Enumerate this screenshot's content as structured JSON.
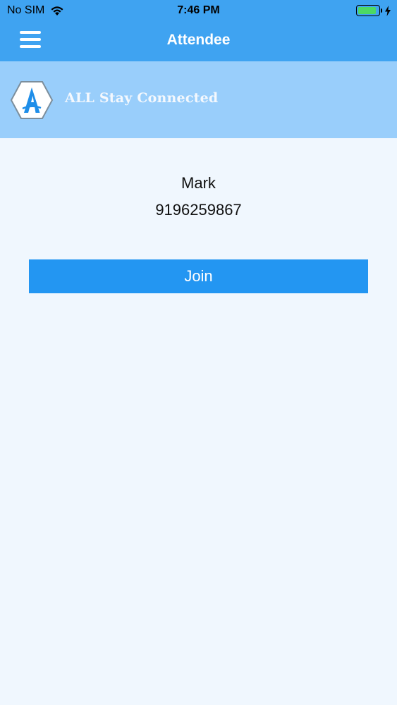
{
  "status_bar": {
    "carrier": "No SIM",
    "time": "7:46 PM",
    "battery_level": 0.9,
    "icons": [
      "wifi-icon",
      "battery-icon",
      "charging-bolt-icon"
    ]
  },
  "nav": {
    "title": "Attendee",
    "menu_icon": "hamburger-menu-icon"
  },
  "brand": {
    "logo_letter": "A",
    "name": "ALL Stay Connected"
  },
  "attendee": {
    "name": "Mark",
    "phone": "9196259867"
  },
  "actions": {
    "join_label": "Join"
  },
  "colors": {
    "nav_bg": "#3FA3F1",
    "banner_bg": "#99CEFB",
    "page_bg": "#F0F7FE",
    "button_bg": "#2396F2",
    "logo_accent": "#1E8EE9"
  }
}
